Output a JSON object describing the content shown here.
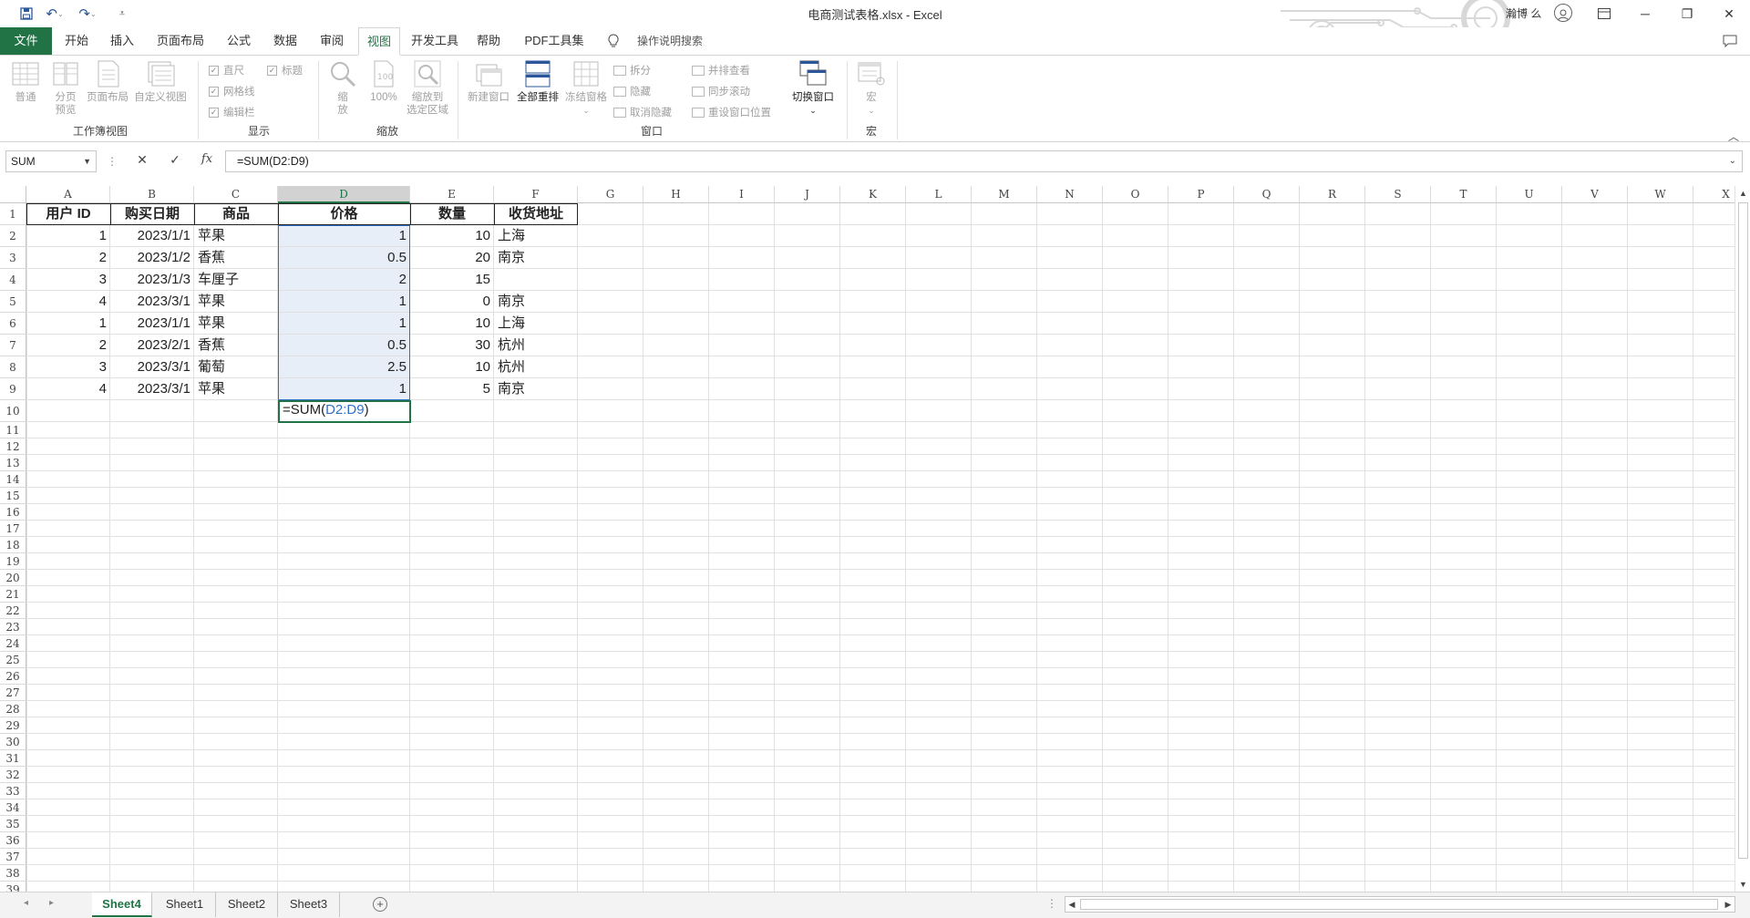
{
  "window": {
    "title": "电商测试表格.xlsx  -  Excel",
    "user": "瀚博 么",
    "controls": {
      "minimize": "─",
      "restore": "❐",
      "close": "✕"
    }
  },
  "quick_access": {
    "save": "save-icon",
    "undo": "undo-icon",
    "redo": "redo-icon",
    "customize": "customize-icon"
  },
  "ribbon_tabs": [
    "文件",
    "开始",
    "插入",
    "页面布局",
    "公式",
    "数据",
    "审阅",
    "视图",
    "开发工具",
    "帮助",
    "PDF工具集"
  ],
  "active_tab": "视图",
  "tell_me": "操作说明搜索",
  "ribbon": {
    "workbook_views": {
      "label": "工作簿视图",
      "normal": "普通",
      "page_break": "分页\n预览",
      "page_layout": "页面布局",
      "custom": "自定义视图"
    },
    "show": {
      "label": "显示",
      "ruler": "直尺",
      "gridlines": "网格线",
      "formula_bar": "编辑栏",
      "headings": "标题"
    },
    "zoom": {
      "label": "缩放",
      "zoom": "缩\n放",
      "zoom100": "100%",
      "zoom_selection": "缩放到\n选定区域"
    },
    "window": {
      "label": "窗口",
      "new_window": "新建窗口",
      "arrange_all": "全部重排",
      "freeze": "冻结窗格",
      "split": "拆分",
      "hide": "隐藏",
      "unhide": "取消隐藏",
      "side_by_side": "并排查看",
      "sync_scroll": "同步滚动",
      "reset_position": "重设窗口位置",
      "switch_windows": "切换窗口"
    },
    "macros": {
      "label": "宏",
      "macros": "宏"
    }
  },
  "formula_bar": {
    "name_box": "SUM",
    "formula": "=SUM(D2:D9)"
  },
  "columns": [
    "A",
    "B",
    "C",
    "D",
    "E",
    "F",
    "G",
    "H",
    "I",
    "J",
    "K",
    "L",
    "M",
    "N",
    "O",
    "P",
    "Q",
    "R",
    "S",
    "T",
    "U",
    "V",
    "W",
    "X"
  ],
  "rows_visible": 39,
  "table": {
    "headers": [
      "用户 ID",
      "购买日期",
      "商品",
      "价格",
      "数量",
      "收货地址"
    ],
    "rows": [
      [
        "1",
        "2023/1/1",
        "苹果",
        "1",
        "10",
        "上海"
      ],
      [
        "2",
        "2023/1/2",
        "香蕉",
        "0.5",
        "20",
        "南京"
      ],
      [
        "3",
        "2023/1/3",
        "车厘子",
        "2",
        "15",
        ""
      ],
      [
        "4",
        "2023/3/1",
        "苹果",
        "1",
        "0",
        "南京"
      ],
      [
        "1",
        "2023/1/1",
        "苹果",
        "1",
        "10",
        "上海"
      ],
      [
        "2",
        "2023/2/1",
        "香蕉",
        "0.5",
        "30",
        "杭州"
      ],
      [
        "3",
        "2023/3/1",
        "葡萄",
        "2.5",
        "10",
        "杭州"
      ],
      [
        "4",
        "2023/3/1",
        "苹果",
        "1",
        "5",
        "南京"
      ]
    ]
  },
  "editing_cell": {
    "prefix": "=SUM(",
    "ref": "D2:D9",
    "suffix": ")"
  },
  "sheets": [
    "Sheet4",
    "Sheet1",
    "Sheet2",
    "Sheet3"
  ],
  "active_sheet": "Sheet4"
}
